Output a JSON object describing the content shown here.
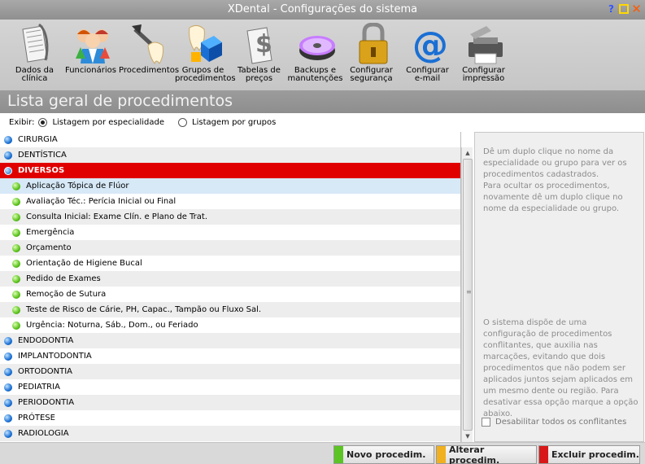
{
  "window": {
    "title": "XDental - Configurações do sistema",
    "controls": {
      "help": "?",
      "close": "✕"
    }
  },
  "toolbar": {
    "buttons": [
      {
        "label": "Dados da\nclínica",
        "icon": "clinic-document-icon"
      },
      {
        "label": "Funcionários",
        "icon": "employees-icon"
      },
      {
        "label": "Procedimentos",
        "icon": "procedures-tools-icon"
      },
      {
        "label": "Grupos de\nprocedimentos",
        "icon": "procedure-groups-icon"
      },
      {
        "label": "Tabelas de\npreços",
        "icon": "price-tables-icon"
      },
      {
        "label": "Backups e\nmanutenções",
        "icon": "backup-disc-icon"
      },
      {
        "label": "Configurar\nsegurança",
        "icon": "security-lock-icon"
      },
      {
        "label": "Configurar\ne-mail",
        "icon": "email-icon"
      },
      {
        "label": "Configurar\nimpressão",
        "icon": "printer-icon"
      }
    ]
  },
  "section": {
    "title": "Lista geral de procedimentos"
  },
  "filter": {
    "label": "Exibir:",
    "option_specialty": "Listagem por especialidade",
    "option_groups": "Listagem por grupos"
  },
  "list": {
    "rows": [
      {
        "label": "CIRURGIA",
        "kind": "group"
      },
      {
        "label": "DENTÍSTICA",
        "kind": "group"
      },
      {
        "label": "DIVERSOS",
        "kind": "group",
        "selected": true
      },
      {
        "label": "Aplicação Tópica de Flúor",
        "kind": "child",
        "highlight": true
      },
      {
        "label": "Avaliação Téc.: Perícia Inicial ou Final",
        "kind": "child"
      },
      {
        "label": "Consulta Inicial: Exame Clín. e Plano de Trat.",
        "kind": "child"
      },
      {
        "label": "Emergência",
        "kind": "child"
      },
      {
        "label": "Orçamento",
        "kind": "child"
      },
      {
        "label": "Orientação de Higiene Bucal",
        "kind": "child"
      },
      {
        "label": "Pedido de Exames",
        "kind": "child"
      },
      {
        "label": "Remoção de Sutura",
        "kind": "child"
      },
      {
        "label": "Teste de Risco de Cárie, PH, Capac., Tampão ou Fluxo Sal.",
        "kind": "child"
      },
      {
        "label": "Urgência: Noturna, Sáb., Dom., ou Feriado",
        "kind": "child"
      },
      {
        "label": "ENDODONTIA",
        "kind": "group"
      },
      {
        "label": "IMPLANTODONTIA",
        "kind": "group"
      },
      {
        "label": "ORTODONTIA",
        "kind": "group"
      },
      {
        "label": "PEDIATRIA",
        "kind": "group"
      },
      {
        "label": "PERIODONTIA",
        "kind": "group"
      },
      {
        "label": "PRÓTESE",
        "kind": "group"
      },
      {
        "label": "RADIOLOGIA",
        "kind": "group"
      }
    ]
  },
  "info": {
    "top_text": "Dê um duplo clique no nome da especialidade ou grupo para ver os procedimentos cadastrados.\nPara ocultar os procedimentos, novamente dê um duplo clique no nome da especialidade ou grupo.",
    "bottom_text": "O sistema dispõe de uma configuração de procedimentos conflitantes, que auxilia nas marcações, evitando que dois procedimentos que não podem ser aplicados juntos sejam aplicados em um mesmo dente ou região. Para desativar essa opção marque a opção abaixo.",
    "checkbox_label": "Desabilitar todos os conflitantes"
  },
  "actions": {
    "new_label": "Novo procedim.",
    "edit_label": "Alterar procedim.",
    "delete_label": "Excluir procedim.",
    "colors": {
      "new": "#5cc424",
      "edit": "#f0b020",
      "delete": "#d81818"
    }
  }
}
